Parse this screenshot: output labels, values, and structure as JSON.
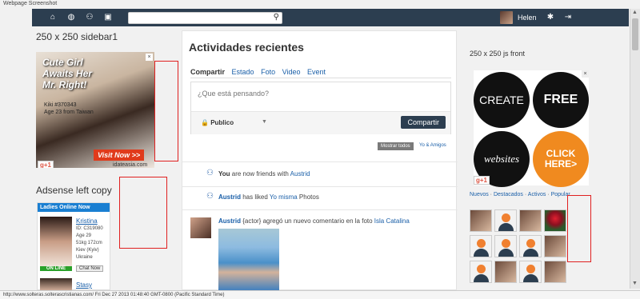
{
  "window": {
    "caption": "Webpage Screenshot"
  },
  "topbar": {
    "icons": [
      "home-icon",
      "globe-icon",
      "people-icon",
      "chat-icon"
    ],
    "search": {
      "value": "",
      "placeholder": ""
    },
    "user": {
      "name": "Helen"
    },
    "right_icons": [
      "gear-icon",
      "logout-icon"
    ]
  },
  "left_sidebar": {
    "title": "250 x 250 sidebar1",
    "ad1": {
      "headline": [
        "Cute Girl",
        "Awaits Her",
        "Mr. Right!"
      ],
      "info": [
        "Kiki #370343",
        "Age 23 from Taiwan"
      ],
      "cta": "Visit Now >>",
      "domain": "idateasia.com",
      "plus": "g+1",
      "close": "×"
    },
    "ad2_title": "Adsense left copy",
    "ad2": {
      "header": "Ladies Online Now",
      "profile1": {
        "name": "Kristina",
        "details": [
          "ID: C319080",
          "Age 29",
          "51kg 172cm",
          "Kiev (Kyiv)",
          "Ukraine"
        ],
        "badge": "ON LINE",
        "chat": "Chat Now"
      },
      "profile2": {
        "name": "Stasy"
      }
    }
  },
  "main": {
    "title": "Actividades recientes",
    "tabs": [
      "Compartir",
      "Estado",
      "Foto",
      "Video",
      "Event"
    ],
    "composer": {
      "placeholder": "¿Que está pensando?",
      "privacy": "Publico",
      "share_button": "Compartir"
    },
    "filters": {
      "all": "Mostrar todos",
      "mine": "Yo & Amigos"
    },
    "feed": [
      {
        "bold": "You",
        "mid": " are now friends with ",
        "link": "Austrid"
      },
      {
        "link1": "Austrid",
        "mid": " has liked ",
        "link2": "Yo misma",
        "tail": " Photos"
      },
      {
        "link1": "Austrid",
        "mid": " {actor} agregó un nuevo comentario en la foto ",
        "link2": "Isla Catalina"
      }
    ]
  },
  "right_sidebar": {
    "title": "250 x 250 js front",
    "bubbles": [
      "CREATE",
      "FREE",
      "websites",
      "CLICK HERE>"
    ],
    "plus": "g+1",
    "close": "×",
    "tabs": {
      "nuevos": "Nuevos",
      "destacados": "Destacados",
      "activos": "Activos",
      "popular": "Popular"
    }
  },
  "status_bar": {
    "text": "http://www.solteras.solterascristianas.com/ Fri Dec 27 2013 01:48:40 GMT-0800 (Pacific Standard Time)"
  }
}
